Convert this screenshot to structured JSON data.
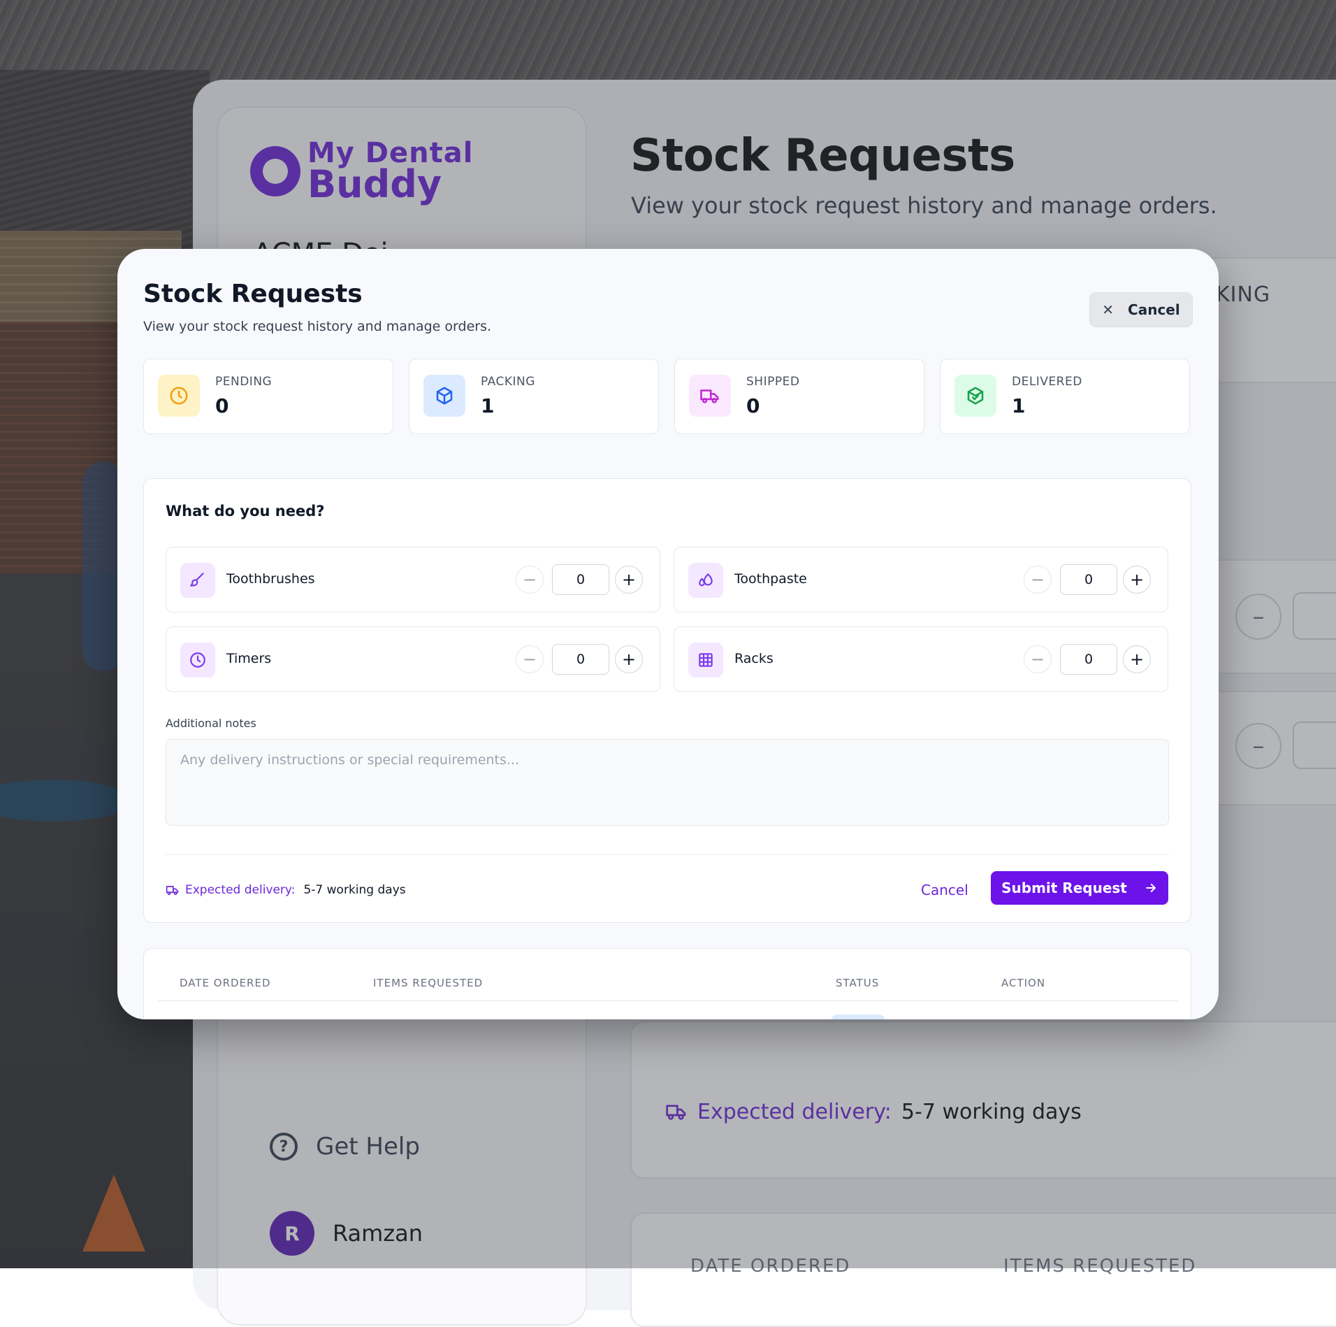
{
  "background_app": {
    "logo": {
      "line1": "My Dental",
      "line2": "Buddy"
    },
    "practice_name": "ACME Dei",
    "title": "Stock Requests",
    "subtitle": "View your stock request history and manage orders.",
    "partial_stat_label": "KING",
    "help_label": "Get Help",
    "user": {
      "initial": "R",
      "name": "Ramzan"
    },
    "delivery": {
      "label": "Expected delivery:",
      "value": "5-7 working days"
    },
    "table_headers": [
      "DATE ORDERED",
      "ITEMS REQUESTED"
    ]
  },
  "modal": {
    "title": "Stock Requests",
    "subtitle": "View your stock request history and manage orders.",
    "cancel_label": "Cancel",
    "stats": [
      {
        "label": "PENDING",
        "value": "0",
        "icon": "clock-icon",
        "color": "#f59e0b",
        "bg": "#fef3c7"
      },
      {
        "label": "PACKING",
        "value": "1",
        "icon": "box-icon",
        "color": "#2563eb",
        "bg": "#dbeafe"
      },
      {
        "label": "SHIPPED",
        "value": "0",
        "icon": "truck-icon",
        "color": "#c026d3",
        "bg": "#fae8ff"
      },
      {
        "label": "DELIVERED",
        "value": "1",
        "icon": "package-check-icon",
        "color": "#16a34a",
        "bg": "#dcfce7"
      }
    ],
    "form": {
      "heading": "What do you need?",
      "items": [
        {
          "name": "Toothbrushes",
          "qty": "0",
          "icon": "brush-icon"
        },
        {
          "name": "Toothpaste",
          "qty": "0",
          "icon": "droplets-icon"
        },
        {
          "name": "Timers",
          "qty": "0",
          "icon": "clock-icon"
        },
        {
          "name": "Racks",
          "qty": "0",
          "icon": "grid-icon"
        }
      ],
      "notes_label": "Additional notes",
      "notes_placeholder": "Any delivery instructions or special requirements...",
      "delivery_label": "Expected delivery:",
      "delivery_value": "5-7 working days",
      "cancel_label": "Cancel",
      "submit_label": "Submit Request"
    },
    "table": {
      "headers": [
        "DATE ORDERED",
        "ITEMS REQUESTED",
        "STATUS",
        "ACTION"
      ]
    },
    "accent_color": "#6d28d9"
  }
}
